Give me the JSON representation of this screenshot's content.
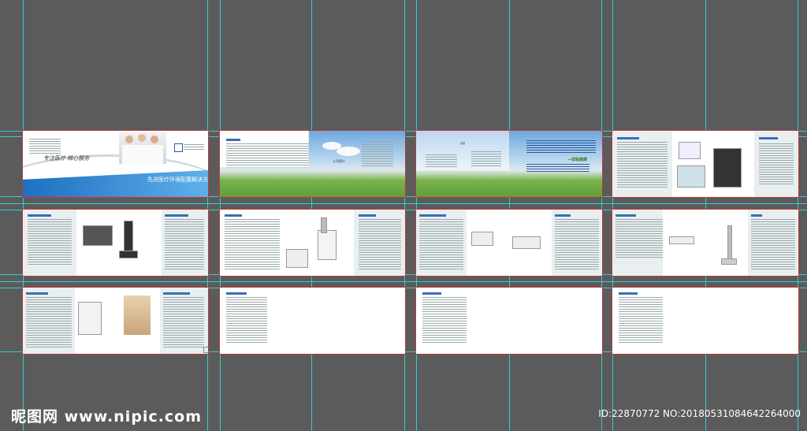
{
  "cover": {
    "slogan": "专注医疗  精心服务",
    "subtitle": "先进医疗环境配置解决方案",
    "small_heading": "LASER HOSPITAL"
  },
  "spread2": {
    "label": "公司简介"
  },
  "spread3": {
    "toc_title": "目录",
    "tagline": "—体贴健康"
  },
  "watermark": {
    "site": "昵图网 www.nipic.com",
    "id_line": "ID:22870772 NO:20180531084642264000"
  }
}
